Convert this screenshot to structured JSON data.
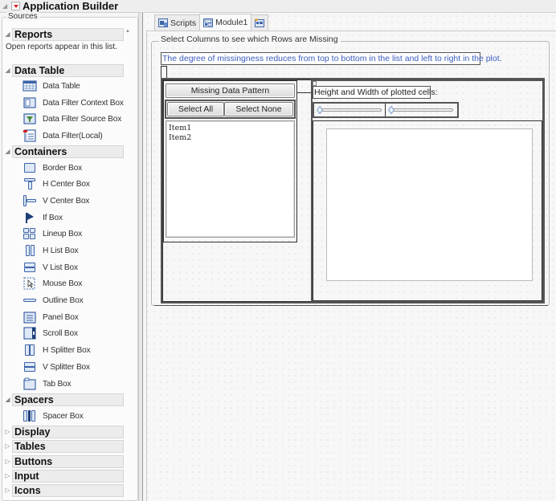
{
  "app": {
    "title": "Application Builder"
  },
  "sources": {
    "legend": "Sources",
    "sections": [
      {
        "label": "Reports",
        "expanded": true,
        "note": "Open reports appear in this list."
      },
      {
        "label": "Data Table",
        "expanded": true,
        "items": [
          {
            "label": "Data Table",
            "icon": "data-table-icon"
          },
          {
            "label": "Data Filter Context Box",
            "icon": "data-filter-context-icon"
          },
          {
            "label": "Data Filter Source Box",
            "icon": "data-filter-source-icon"
          },
          {
            "label": "Data Filter(Local)",
            "icon": "data-filter-local-icon"
          }
        ]
      },
      {
        "label": "Containers",
        "expanded": true,
        "items": [
          {
            "label": "Border Box",
            "icon": "border-box-icon"
          },
          {
            "label": "H Center Box",
            "icon": "h-center-box-icon"
          },
          {
            "label": "V Center Box",
            "icon": "v-center-box-icon"
          },
          {
            "label": "If Box",
            "icon": "flag-icon"
          },
          {
            "label": "Lineup Box",
            "icon": "lineup-box-icon"
          },
          {
            "label": "H List Box",
            "icon": "h-list-box-icon"
          },
          {
            "label": "V List Box",
            "icon": "v-list-box-icon"
          },
          {
            "label": "Mouse Box",
            "icon": "mouse-box-icon"
          },
          {
            "label": "Outline Box",
            "icon": "outline-box-icon"
          },
          {
            "label": "Panel Box",
            "icon": "panel-box-icon"
          },
          {
            "label": "Scroll Box",
            "icon": "scroll-box-icon"
          },
          {
            "label": "H Splitter Box",
            "icon": "h-splitter-box-icon"
          },
          {
            "label": "V Splitter Box",
            "icon": "v-splitter-box-icon"
          },
          {
            "label": "Tab Box",
            "icon": "tab-box-icon"
          }
        ]
      },
      {
        "label": "Spacers",
        "expanded": true,
        "items": [
          {
            "label": "Spacer Box",
            "icon": "spacer-box-icon"
          }
        ]
      },
      {
        "label": "Display",
        "expanded": false
      },
      {
        "label": "Tables",
        "expanded": false
      },
      {
        "label": "Buttons",
        "expanded": false
      },
      {
        "label": "Input",
        "expanded": false
      },
      {
        "label": "Icons",
        "expanded": false
      }
    ]
  },
  "tabs": [
    {
      "label": "Scripts",
      "icon": "scripts-icon",
      "active": false
    },
    {
      "label": "Module1",
      "icon": "module-icon",
      "active": true
    },
    {
      "label": "",
      "icon": "new-module-icon",
      "active": false
    }
  ],
  "canvas": {
    "outline_title": "Select Columns to see which Rows are Missing",
    "description": "The degree of missingness reduces from top to bottom in the list and left to right in the plot.",
    "missing_data_pattern_button": "Missing Data Pattern",
    "select_all_button": "Select All",
    "select_none_button": "Select None",
    "list_items": [
      "Item1",
      "Item2"
    ],
    "size_label": "Height and Width of plotted cells:",
    "height_slider_value": 0,
    "width_slider_value": 0
  }
}
